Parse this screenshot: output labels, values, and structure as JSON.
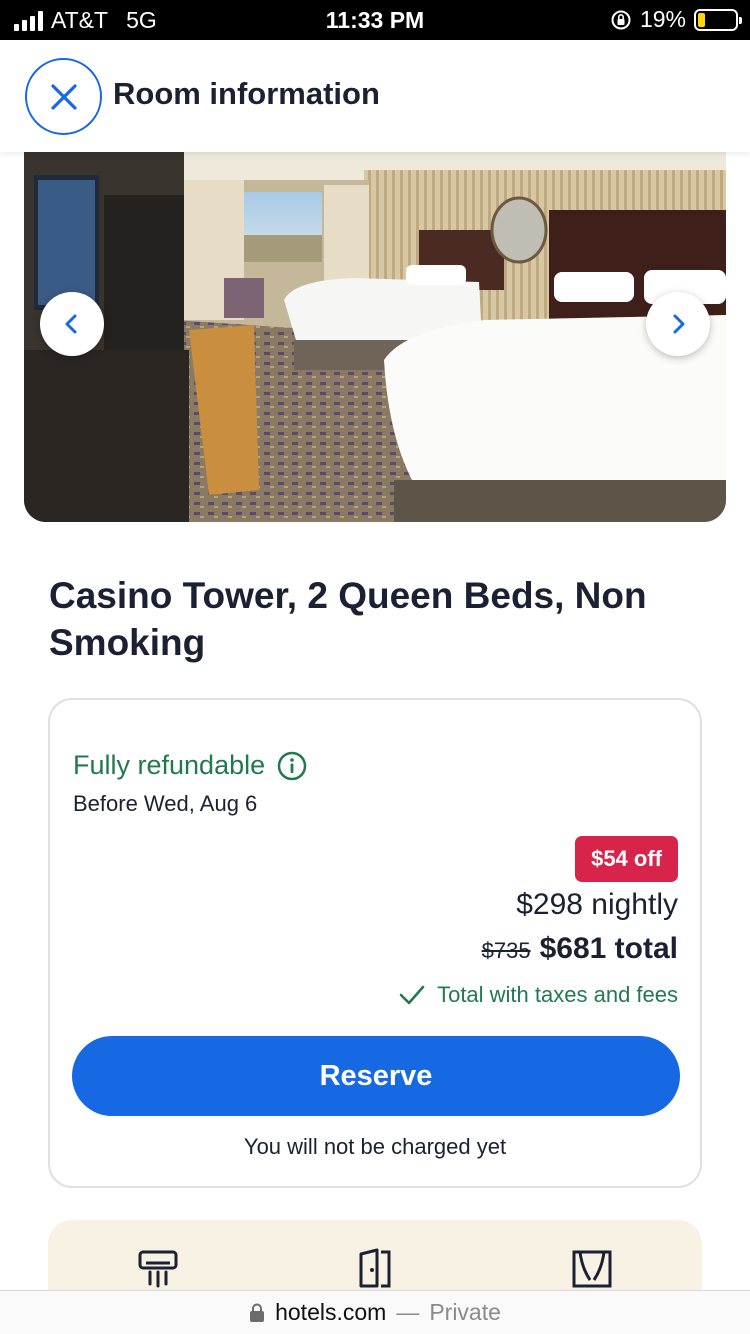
{
  "status_bar": {
    "carrier": "AT&T",
    "network": "5G",
    "time": "11:33 PM",
    "battery": "19%",
    "battery_level": 0.19
  },
  "header": {
    "title": "Room information",
    "close_icon": "close-icon"
  },
  "gallery": {
    "prev_icon": "chevron-left-icon",
    "next_icon": "chevron-right-icon"
  },
  "room": {
    "title": "Casino Tower, 2 Queen Beds, Non Smoking"
  },
  "offer": {
    "refund_label": "Fully refundable",
    "refund_deadline": "Before Wed, Aug 6",
    "discount_badge": "$54 off",
    "nightly_price": "$298 nightly",
    "original_total": "$735",
    "total": "$681 total",
    "taxes_note": "Total with taxes and fees",
    "reserve_label": "Reserve",
    "charge_note": "You will not be charged yet"
  },
  "amenities": {
    "icons": [
      "air-conditioning-icon",
      "door-icon",
      "curtains-icon"
    ]
  },
  "browser": {
    "domain": "hotels.com",
    "separator": "—",
    "mode": "Private"
  },
  "colors": {
    "brand_blue": "#1668e3",
    "refund_green": "#227950",
    "discount_red": "#d8234a",
    "text_dark": "#1b2033",
    "amenities_bg": "#f7f2e4"
  }
}
